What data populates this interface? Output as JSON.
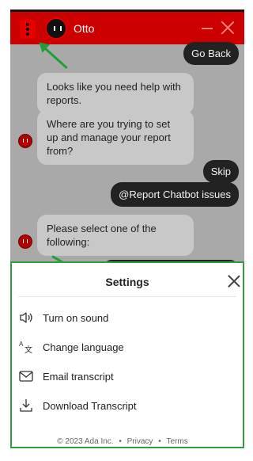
{
  "header": {
    "bot_name": "Otto",
    "icons": {
      "menu": "vertical-dots-icon",
      "minimize": "minimize-icon",
      "close": "close-icon"
    }
  },
  "chat": {
    "messages": [
      {
        "from": "user",
        "text": "Go Back"
      },
      {
        "from": "bot",
        "text": "Looks like you need help with reports."
      },
      {
        "from": "bot",
        "text": "Where are you trying to set up and manage your report from?"
      },
      {
        "from": "user",
        "text": "Skip"
      },
      {
        "from": "user",
        "text": "@Report Chatbot issues"
      },
      {
        "from": "bot",
        "text": "Please select one of the following:"
      }
    ]
  },
  "settings": {
    "title": "Settings",
    "items": [
      {
        "label": "Turn on sound",
        "icon": "speaker-icon"
      },
      {
        "label": "Change language",
        "icon": "language-icon"
      },
      {
        "label": "Email transcript",
        "icon": "envelope-icon"
      },
      {
        "label": "Download Transcript",
        "icon": "download-icon"
      }
    ]
  },
  "footer": {
    "copyright": "© 2023 Ada Inc.",
    "separator": "•",
    "privacy": "Privacy",
    "terms": "Terms"
  },
  "colors": {
    "header_bg": "#cc0000",
    "chat_bg": "#a9a9a9",
    "bot_bubble": "#c8c8c8",
    "user_bubble": "#222222",
    "annotation_green": "#2e9e3f"
  }
}
